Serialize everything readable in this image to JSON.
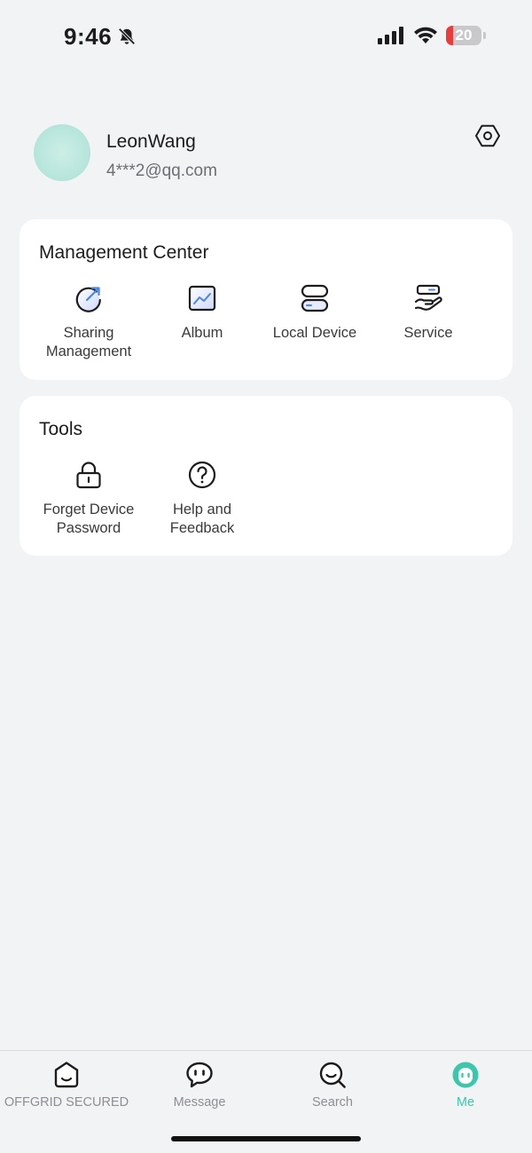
{
  "status_bar": {
    "time": "9:46",
    "battery_level": 20,
    "battery_text": "20",
    "icons": [
      "bell-slash-icon",
      "signal-icon",
      "wifi-icon",
      "battery-icon"
    ]
  },
  "profile": {
    "name": "LeonWang",
    "email": "4***2@qq.com",
    "settings_icon": "settings-hexagon-icon"
  },
  "management_center": {
    "title": "Management Center",
    "items": [
      {
        "label": "Sharing\nManagement",
        "icon": "sharing-icon"
      },
      {
        "label": "Album",
        "icon": "album-icon"
      },
      {
        "label": "Local Device",
        "icon": "local-device-icon"
      },
      {
        "label": "Service",
        "icon": "service-icon"
      }
    ]
  },
  "tools": {
    "title": "Tools",
    "items": [
      {
        "label": "Forget Device\nPassword",
        "icon": "lock-icon"
      },
      {
        "label": "Help and\nFeedback",
        "icon": "help-icon"
      }
    ]
  },
  "tabbar": {
    "active_color": "#3cc7ad",
    "tabs": [
      {
        "label": "OFFGRID SECURED",
        "icon": "home-icon",
        "active": false
      },
      {
        "label": "Message",
        "icon": "message-icon",
        "active": false
      },
      {
        "label": "Search",
        "icon": "search-icon",
        "active": false
      },
      {
        "label": "Me",
        "icon": "me-icon",
        "active": true
      }
    ]
  }
}
